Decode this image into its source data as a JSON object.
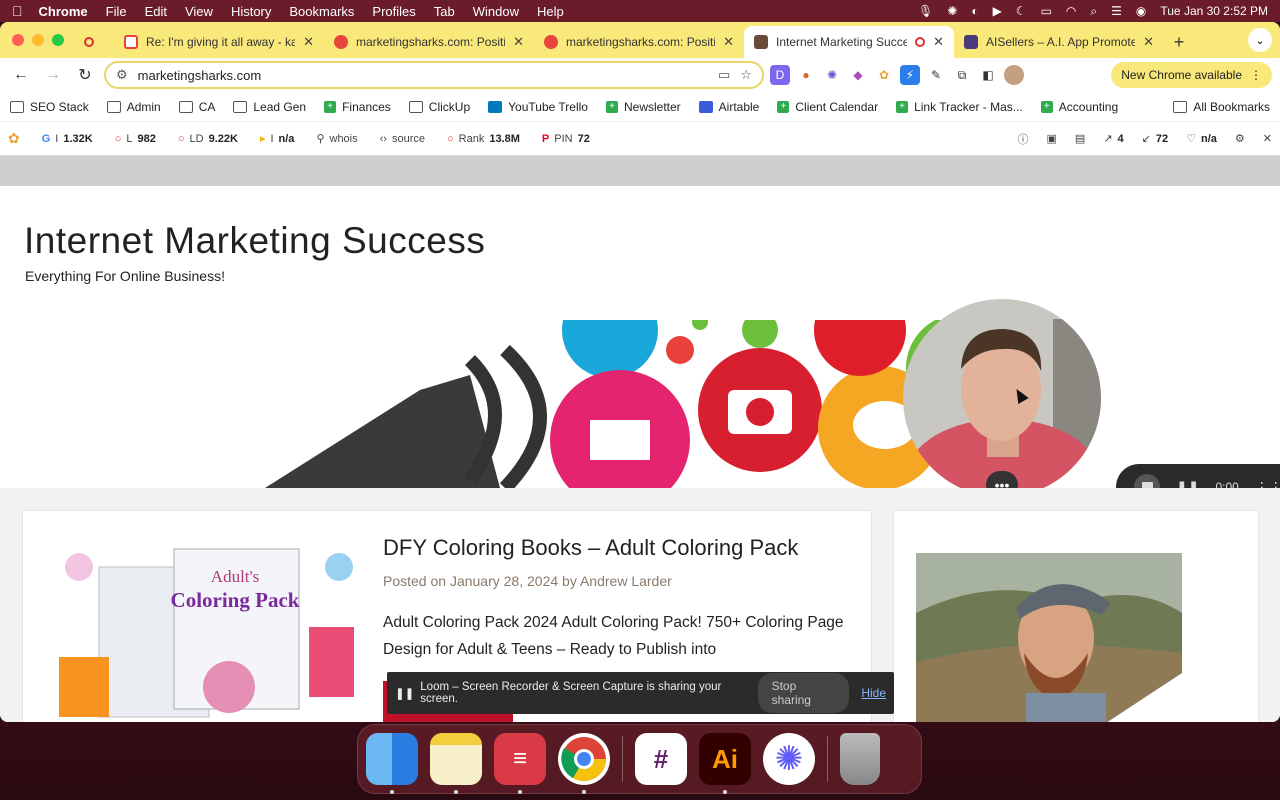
{
  "menubar": {
    "app": "Chrome",
    "items": [
      "File",
      "Edit",
      "View",
      "History",
      "Bookmarks",
      "Profiles",
      "Tab",
      "Window",
      "Help"
    ],
    "datetime": "Tue Jan 30  2:52 PM"
  },
  "tabs": [
    {
      "title": "",
      "favicon_color": "#d93025",
      "kind": "recording"
    },
    {
      "title": "Re: I'm giving it all away - kai",
      "favicon_color": "#ea4335"
    },
    {
      "title": "marketingsharks.com: Positio",
      "favicon_color": "#e8453c"
    },
    {
      "title": "marketingsharks.com: Positio",
      "favicon_color": "#e8453c"
    },
    {
      "title": "Internet Marketing Succe",
      "favicon_color": "#6a4a3a",
      "active": true
    },
    {
      "title": "AISellers – A.I. App Promotes",
      "favicon_color": "#4a3a7a"
    }
  ],
  "toolbar": {
    "url": "marketingsharks.com",
    "new_chrome": "New Chrome available"
  },
  "bookmarks": [
    {
      "label": "SEO Stack",
      "type": "folder"
    },
    {
      "label": "Admin",
      "type": "folder"
    },
    {
      "label": "CA",
      "type": "folder"
    },
    {
      "label": "Lead Gen",
      "type": "folder"
    },
    {
      "label": "Finances",
      "type": "sheet"
    },
    {
      "label": "ClickUp",
      "type": "folder"
    },
    {
      "label": "YouTube Trello",
      "type": "trello"
    },
    {
      "label": "Newsletter",
      "type": "sheet"
    },
    {
      "label": "Airtable",
      "type": "airtable"
    },
    {
      "label": "Client Calendar",
      "type": "sheet"
    },
    {
      "label": "Link Tracker - Mas...",
      "type": "sheet"
    },
    {
      "label": "Accounting",
      "type": "sheet"
    }
  ],
  "all_bookmarks": "All Bookmarks",
  "seobar": {
    "items": [
      {
        "prefix": "I",
        "value": "1.32K",
        "icon": "G"
      },
      {
        "prefix": "L",
        "value": "982",
        "icon": "○"
      },
      {
        "prefix": "LD",
        "value": "9.22K",
        "icon": "○"
      },
      {
        "prefix": "I",
        "value": "n/a",
        "icon": "▸"
      },
      {
        "prefix": "",
        "value": "whois",
        "icon": "👤"
      },
      {
        "prefix": "",
        "value": "source",
        "icon": "‹›"
      },
      {
        "prefix": "Rank",
        "value": "13.8M",
        "icon": "○"
      },
      {
        "prefix": "PIN",
        "value": "72",
        "icon": "P"
      }
    ],
    "right": [
      "4",
      "72",
      "n/a"
    ]
  },
  "site": {
    "title": "Internet Marketing Success",
    "tagline": "Everything For Online Business!"
  },
  "post": {
    "title": "DFY Coloring Books – Adult Coloring Pack",
    "meta_prefix": "Posted on",
    "date": "January 28, 2024",
    "meta_by": "by",
    "author": "Andrew Larder",
    "excerpt": "Adult Coloring Pack 2024 Adult Coloring Pack! 750+ Coloring Page Design for Adult & Teens – Ready to Publish into",
    "thumb_title_1": "Adult's",
    "thumb_title_2": "Coloring Pack"
  },
  "recorder": {
    "time": "0:00"
  },
  "share_notice": {
    "text": "Loom – Screen Recorder & Screen Capture is sharing your screen.",
    "stop": "Stop sharing",
    "hide": "Hide"
  },
  "dock": [
    "Finder",
    "Notes",
    "Express",
    "Chrome",
    "Slack",
    "Ai",
    "Loom",
    "Trash"
  ]
}
